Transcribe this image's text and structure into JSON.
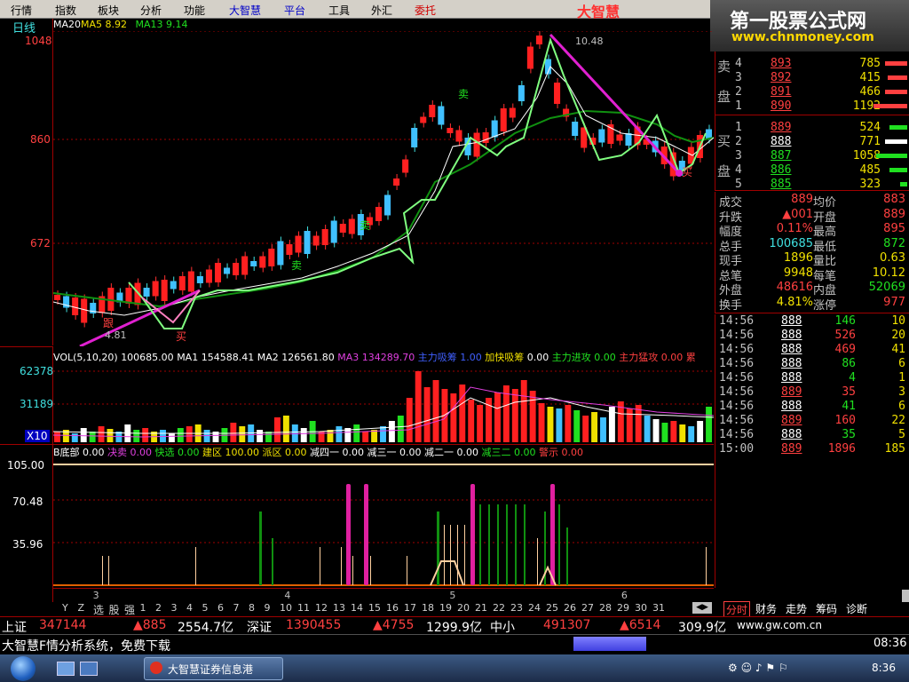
{
  "menu": [
    "行情",
    "指数",
    "板块",
    "分析",
    "功能",
    "大智慧",
    "平台",
    "工具",
    "外汇",
    "委托"
  ],
  "brand_mid": "大智慧",
  "banner": {
    "title": "第一股票公式网",
    "url": "www.chnmoney.com"
  },
  "chart_label": "日线",
  "ma_header": {
    "ma20": "MA20",
    "ma5": "MA5 8.92",
    "ma13": "MA13 9.14"
  },
  "price_axis": [
    "1048",
    "860",
    "672"
  ],
  "peak_label": "10.48",
  "low_label": "4.81",
  "annotations": {
    "gen": "跟",
    "mai_low": "买",
    "mai_right": "买",
    "sell1": "卖",
    "sell2": "卖",
    "sell3": "卖"
  },
  "vol_header": {
    "vol": "VOL(5,10,20)",
    "vol_val": "100685.00",
    "ma1": "MA1",
    "ma1_val": "154588.41",
    "ma2": "MA2",
    "ma2_val": "126561.80",
    "ma3": "MA3",
    "ma3_val": "134289.70",
    "zljc": "主力吸筹",
    "zljc_val": "1.00",
    "jkxc": "加快吸筹",
    "jkxc_val": "0.00",
    "zljg": "主力进攻",
    "zljg_val": "0.00",
    "zlmg": "主力猛攻",
    "zlmg_val": "0.00",
    "more": "累"
  },
  "vol_axis": [
    "62378",
    "31189",
    "X10"
  ],
  "ind_header": {
    "dibu": "B底部",
    "dibu_val": "0.00",
    "juemai": "决卖",
    "juemai_val": "0.00",
    "kuaixuan": "快选",
    "kuaixuan_val": "0.00",
    "jianqu": "建区",
    "jianqu_val": "100.00",
    "paiqu": "派区",
    "paiqu_val": "0.00",
    "jiansi": "减四一",
    "jiansi_val": "0.00",
    "jiansan": "减三一",
    "jiansan_val": "0.00",
    "jianer": "减二一",
    "jianer_val": "0.00",
    "jiansaner": "减三二",
    "jiansaner_val": "0.00",
    "jingshi": "警示",
    "jingshi_val": "0.00"
  },
  "ind_axis": [
    "105.00",
    "70.48",
    "35.96"
  ],
  "x_axis": [
    {
      "label": "3",
      "pos": 0.06
    },
    {
      "label": "4",
      "pos": 0.35
    },
    {
      "label": "5",
      "pos": 0.6
    },
    {
      "label": "6",
      "pos": 0.86
    }
  ],
  "orderbook": {
    "sell_label": [
      "卖",
      "盘"
    ],
    "buy_label": [
      "买",
      "盘"
    ],
    "sells": [
      [
        "4",
        "893",
        "785"
      ],
      [
        "3",
        "892",
        "415"
      ],
      [
        "2",
        "891",
        "466"
      ],
      [
        "1",
        "890",
        "1192"
      ]
    ],
    "buys": [
      [
        "1",
        "889",
        "524"
      ],
      [
        "2",
        "888",
        "771"
      ],
      [
        "3",
        "887",
        "1058"
      ],
      [
        "4",
        "886",
        "485"
      ],
      [
        "5",
        "885",
        "323"
      ]
    ]
  },
  "stats": [
    [
      "成交",
      "889",
      "均价",
      "883"
    ],
    [
      "升跌",
      "▲001",
      "开盘",
      "889"
    ],
    [
      "幅度",
      "0.11%",
      "最高",
      "895"
    ],
    [
      "总手",
      "100685",
      "最低",
      "872"
    ],
    [
      "现手",
      "1896",
      "量比",
      "0.63"
    ],
    [
      "总笔",
      "9948",
      "每笔",
      "10.12"
    ],
    [
      "外盘",
      "48616",
      "内盘",
      "52069"
    ],
    [
      "换手",
      "4.81%",
      "涨停",
      "977"
    ]
  ],
  "ticks": [
    [
      "14:56",
      "888",
      "146",
      "10"
    ],
    [
      "14:56",
      "888",
      "526",
      "20"
    ],
    [
      "14:56",
      "888",
      "469",
      "41"
    ],
    [
      "14:56",
      "888",
      "86",
      "6"
    ],
    [
      "14:56",
      "888",
      "4",
      "1"
    ],
    [
      "14:56",
      "889",
      "35",
      "3"
    ],
    [
      "14:56",
      "888",
      "41",
      "6"
    ],
    [
      "14:56",
      "889",
      "160",
      "22"
    ],
    [
      "14:56",
      "888",
      "35",
      "5"
    ],
    [
      "15:00",
      "889",
      "1896",
      "185"
    ]
  ],
  "bottom_tabs": [
    "Y",
    "Z",
    "选",
    "股",
    "强",
    "1",
    "2",
    "3",
    "4",
    "5",
    "6",
    "7",
    "8",
    "9",
    "10",
    "11",
    "12",
    "13",
    "14",
    "15",
    "16",
    "17",
    "18",
    "19",
    "20",
    "21",
    "22",
    "23",
    "24",
    "25",
    "26",
    "27",
    "28",
    "29",
    "30",
    "31"
  ],
  "right_tabs": [
    "分时",
    "财务",
    "走势",
    "筹码",
    "诊断"
  ],
  "status_line": {
    "sh_label": "上证",
    "sh_vol": "347144",
    "sh_idx": "▲885",
    "sh_amt": "2554.7亿",
    "sz_label": "深证",
    "sz_vol": "1390455",
    "sz_idx": "▲4755",
    "sz_amt": "1299.9亿",
    "zx_label": "中小",
    "zx_vol": "491307",
    "zx_idx": "▲6514",
    "zx_amt": "309.9亿",
    "site": "www.gw.com.cn"
  },
  "scroll_msg": "大智慧F情分析系统，免费下载",
  "clock_status": "08:36",
  "taskbar": {
    "app": "大智慧证券信息港",
    "time": "8:36"
  }
}
